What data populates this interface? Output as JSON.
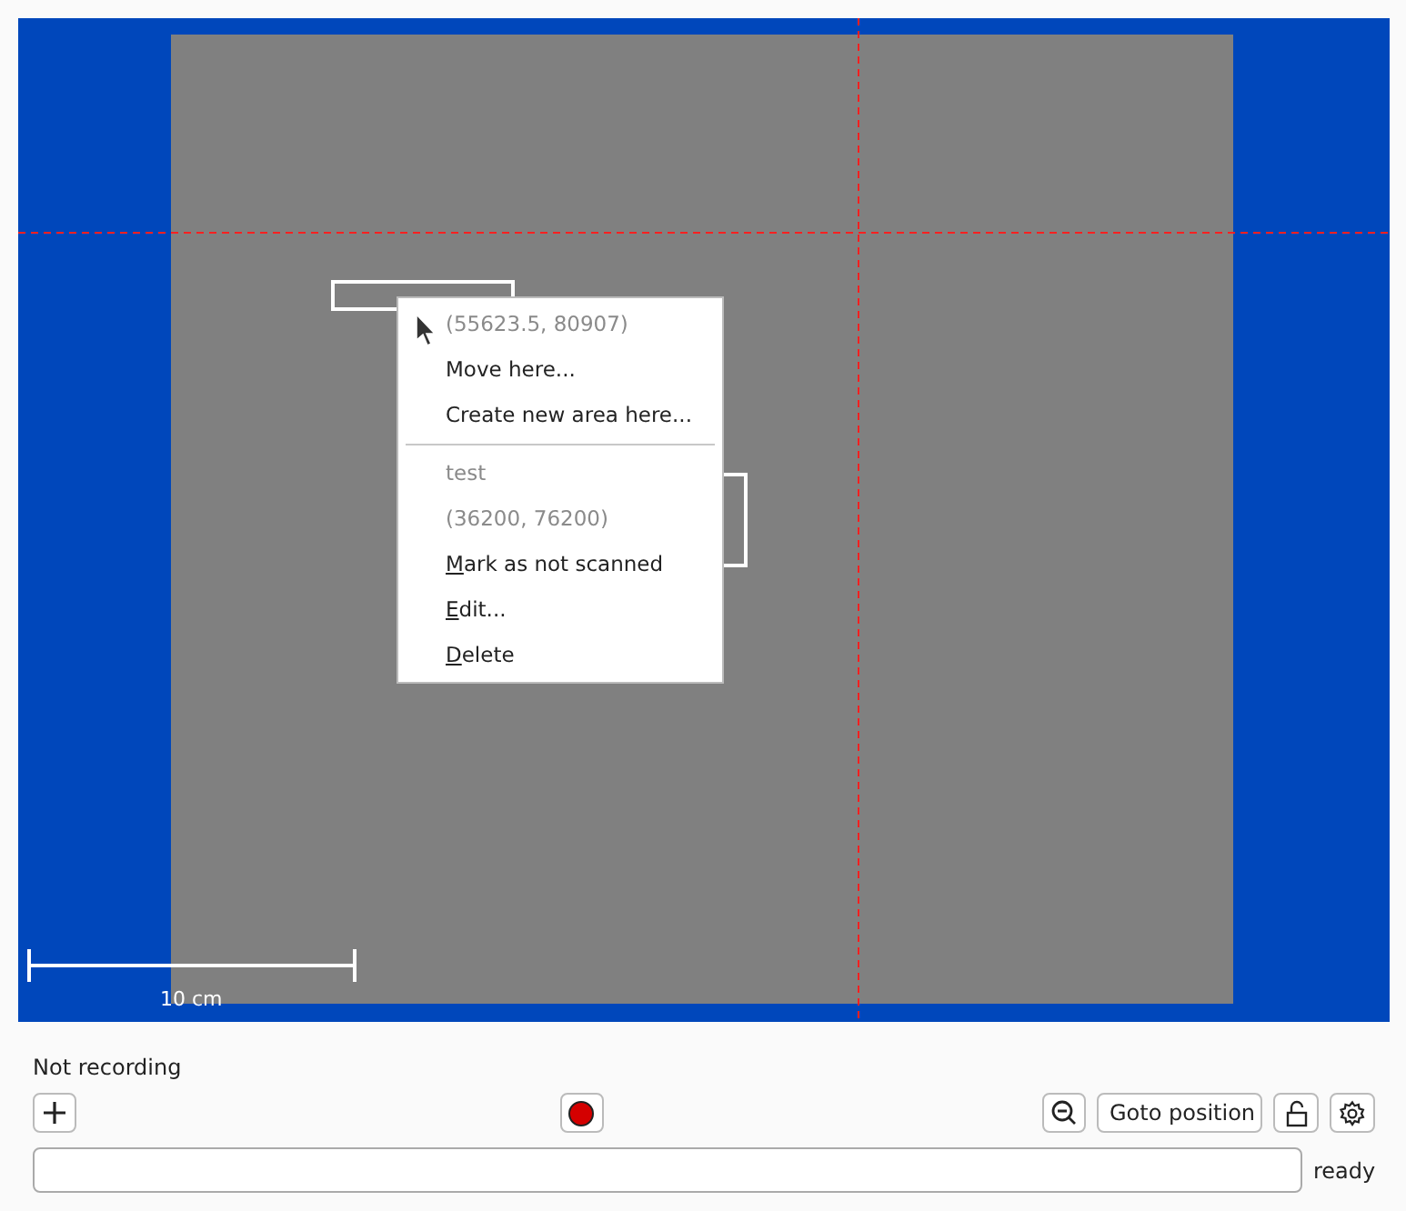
{
  "map": {
    "scale_label": "10 cm"
  },
  "context_menu": {
    "sections": [
      [
        {
          "label": "(55623.5, 80907)",
          "disabled": true,
          "mnemonic": false
        },
        {
          "label": "Move here...",
          "disabled": false,
          "mnemonic": false
        },
        {
          "label": "Create new area here...",
          "disabled": false,
          "mnemonic": false
        }
      ],
      [
        {
          "label": "test",
          "disabled": true,
          "mnemonic": false
        },
        {
          "label": "(36200, 76200)",
          "disabled": true,
          "mnemonic": false
        },
        {
          "label": "Mark as not scanned",
          "disabled": false,
          "mnemonic": true
        },
        {
          "label": "Edit...",
          "disabled": false,
          "mnemonic": true
        },
        {
          "label": "Delete",
          "disabled": false,
          "mnemonic": true
        }
      ]
    ]
  },
  "status": "Not recording",
  "toolbar": {
    "goto": "Goto position"
  },
  "status_field": {
    "state": "ready"
  }
}
